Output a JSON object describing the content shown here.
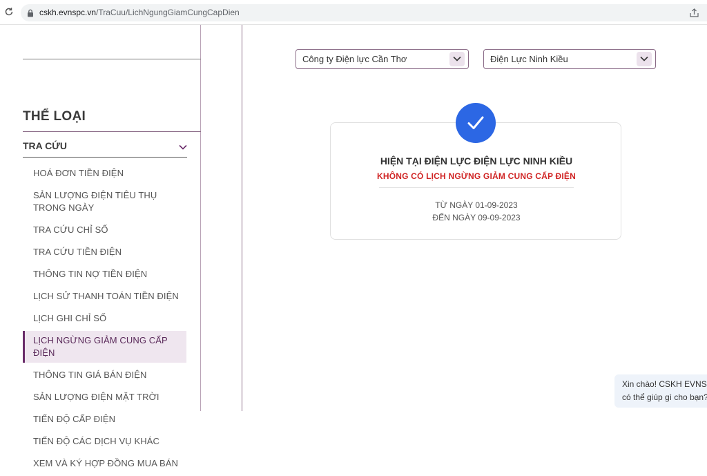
{
  "browser": {
    "url_domain": "cskh.evnspc.vn",
    "url_path": "/TraCuu/LichNgungGiamCungCapDien",
    "icons": [
      "reload-icon",
      "lock-icon",
      "share-icon"
    ]
  },
  "sidebar": {
    "category_title": "THỂ LOẠI",
    "section_label": "TRA CỨU",
    "items": [
      {
        "label": "HOÁ ĐƠN TIỀN ĐIỆN"
      },
      {
        "label": "SẢN LƯỢNG ĐIỆN TIÊU THỤ TRONG NGÀY"
      },
      {
        "label": "TRA CỨU CHỈ SỐ"
      },
      {
        "label": "TRA CỨU TIỀN ĐIỆN"
      },
      {
        "label": "THÔNG TIN NỢ TIỀN ĐIỆN"
      },
      {
        "label": "LỊCH SỬ THANH TOÁN TIỀN ĐIỆN"
      },
      {
        "label": "LỊCH GHI CHỈ SỐ"
      },
      {
        "label": "LỊCH NGỪNG GIẢM CUNG CẤP ĐIỆN",
        "active": true
      },
      {
        "label": "THÔNG TIN GIÁ BÁN ĐIỆN"
      },
      {
        "label": "SẢN LƯỢNG ĐIỆN MẶT TRỜI"
      },
      {
        "label": "TIẾN ĐỘ CẤP ĐIỆN"
      },
      {
        "label": "TIẾN ĐỘ CÁC DỊCH VỤ KHÁC"
      },
      {
        "label": "XEM VÀ KÝ HỢP ĐỒNG MUA BÁN"
      }
    ]
  },
  "filters": {
    "company_value": "Công ty Điện lực Cần Thơ",
    "unit_value": "Điện Lực Ninh Kiều"
  },
  "result": {
    "title": "HIỆN TẠI ĐIỆN LỰC ĐIỆN LỰC NINH KIỀU",
    "subtitle": "KHÔNG CÓ LỊCH NGỪNG GIẢM CUNG CẤP ĐIỆN",
    "from_date": "TỪ NGÀY 01-09-2023",
    "to_date": "ĐẾN NGÀY 09-09-2023"
  },
  "chat": {
    "line1": "Xin chào! CSKH EVNSPC",
    "line2": "có thể giúp gì cho bạn?"
  },
  "colors": {
    "accent_purple": "#6a2c6a",
    "check_blue": "#2c67e4",
    "alert_red": "#d02424"
  }
}
